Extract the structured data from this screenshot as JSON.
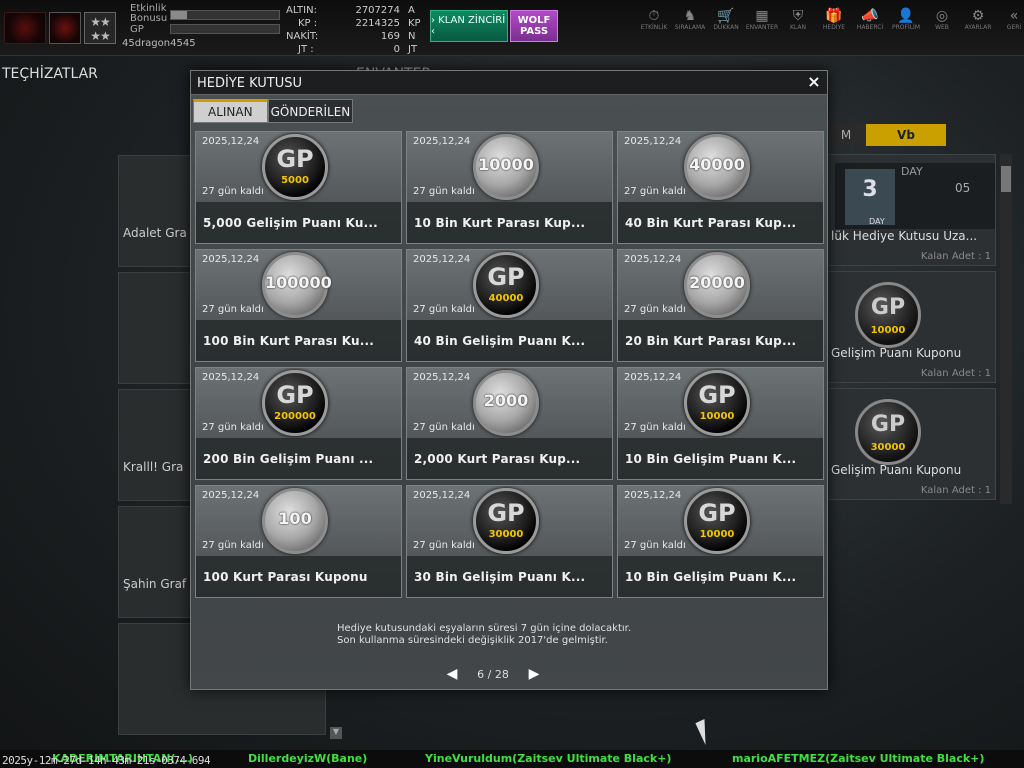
{
  "topbar": {
    "event_bonus_label": "Etkinlik\nBonusu",
    "event_bonus_fill": 0.15,
    "gp_label": "GP",
    "gp_fill": 0.0,
    "username": "45dragon4545",
    "rank_stars": "★★\n★★",
    "currencies": [
      {
        "label": "ALTIN:",
        "value": "2707274",
        "unit": "A"
      },
      {
        "label": "KP :",
        "value": "2214325",
        "unit": "KP"
      },
      {
        "label": "NAKİT:",
        "value": "169",
        "unit": "N"
      },
      {
        "label": "JT :",
        "value": "0",
        "unit": "JT"
      }
    ],
    "klan_button": "› KLAN ZİNCİRİ ‹",
    "wolf_button": "WOLF\nPASS",
    "nav": [
      {
        "icon": "⏱",
        "label": "ETKİNLİK"
      },
      {
        "icon": "♞",
        "label": "SIRALAMA"
      },
      {
        "icon": "🛒",
        "label": "DÜKKAN"
      },
      {
        "icon": "▦",
        "label": "ENVANTER"
      },
      {
        "icon": "⛨",
        "label": "KLAN"
      },
      {
        "icon": "🎁",
        "label": "HEDİYE"
      },
      {
        "icon": "📣",
        "label": "HABERCİ"
      },
      {
        "icon": "👤",
        "label": "PROFİLİM"
      },
      {
        "icon": "◎",
        "label": "WEB"
      },
      {
        "icon": "⚙",
        "label": "AYARLAR"
      },
      {
        "icon": "«",
        "label": "GERİ"
      }
    ]
  },
  "background": {
    "tech_title": "TEÇHİZATLAR",
    "env_title": "ENVANTER",
    "left_cards": [
      "Adalet Gra",
      "",
      "Kralll! Gra",
      "Şahin Graf",
      ""
    ],
    "right_tabs": [
      "M",
      "Vb"
    ],
    "right_cards": [
      {
        "name": "lük Hediye Kutusu Uza...",
        "kalan": "Kalan Adet : 1",
        "type": "day"
      },
      {
        "name": "Gelişim Puanı Kuponu",
        "kalan": "Kalan Adet : 1",
        "type": "gp",
        "amount": "10000"
      },
      {
        "name": "Gelişim Puanı Kuponu",
        "kalan": "Kalan Adet : 1",
        "type": "gp",
        "amount": "30000"
      }
    ],
    "day_graphic": {
      "big": "3",
      "day": "DAY",
      "small_day": "DAY",
      "time": "05"
    }
  },
  "modal": {
    "title": "HEDİYE KUTUSU",
    "close": "×",
    "tabs": [
      "ALINAN",
      "GÖNDERİLEN"
    ],
    "items": [
      {
        "date": "2025,12,24",
        "days": "27 gün kaldı",
        "name": "5,000 Gelişim Puanı Ku...",
        "coin": "gp",
        "amount": "5000"
      },
      {
        "date": "2025,12,24",
        "days": "27 gün kaldı",
        "name": "10 Bin Kurt Parası Kup...",
        "coin": "kp",
        "amount": "10000"
      },
      {
        "date": "2025,12,24",
        "days": "27 gün kaldı",
        "name": "40 Bin Kurt Parası Kup...",
        "coin": "kp",
        "amount": "40000"
      },
      {
        "date": "2025,12,24",
        "days": "27 gün kaldı",
        "name": "100 Bin Kurt Parası Ku...",
        "coin": "kp",
        "amount": "100000"
      },
      {
        "date": "2025,12,24",
        "days": "27 gün kaldı",
        "name": "40 Bin Gelişim Puanı K...",
        "coin": "gp",
        "amount": "40000"
      },
      {
        "date": "2025,12,24",
        "days": "27 gün kaldı",
        "name": "20 Bin Kurt Parası Kup...",
        "coin": "kp",
        "amount": "20000"
      },
      {
        "date": "2025,12,24",
        "days": "27 gün kaldı",
        "name": "200 Bin Gelişim Puanı ...",
        "coin": "gp",
        "amount": "200000"
      },
      {
        "date": "2025,12,24",
        "days": "27 gün kaldı",
        "name": "2,000  Kurt Parası Kup...",
        "coin": "kp",
        "amount": "2000"
      },
      {
        "date": "2025,12,24",
        "days": "27 gün kaldı",
        "name": "10 Bin Gelişim Puanı K...",
        "coin": "gp",
        "amount": "10000"
      },
      {
        "date": "2025,12,24",
        "days": "27 gün kaldı",
        "name": "100 Kurt Parası Kuponu",
        "coin": "kp",
        "amount": "100"
      },
      {
        "date": "2025,12,24",
        "days": "27 gün kaldı",
        "name": "30 Bin Gelişim Puanı K...",
        "coin": "gp",
        "amount": "30000"
      },
      {
        "date": "2025,12,24",
        "days": "27 gün kaldı",
        "name": "10 Bin Gelişim Puanı K...",
        "coin": "gp",
        "amount": "10000"
      }
    ],
    "notice_line1": "Hediye kutusundaki eşyaların süresi 7 gün içine dolacaktır.",
    "notice_line2": "Son kullanma süresindeki değişiklik 2017'de gelmiştir.",
    "pagination": {
      "prev": "◀",
      "text": "6 / 28",
      "next": "▶"
    }
  },
  "ticker": [
    "KADERIMTARIHTAN(...)",
    "DillerdeyizW(Bane)",
    "YineVuruldum(Zaitsev Ultimate Black+)",
    "marioAFETMEZ(Zaitsev Ultimate Black+)"
  ],
  "timestamp": "2025y-12m-27d-14h-43m-21s-0374-694"
}
